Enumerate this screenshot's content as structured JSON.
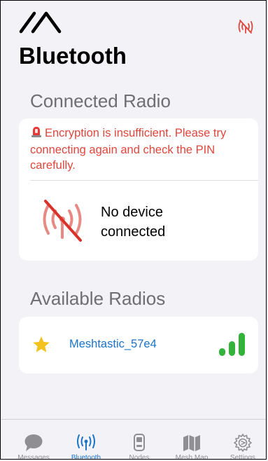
{
  "header": {
    "title": "Bluetooth",
    "logo_icon": "meshtastic-logo-icon",
    "status_icon": "antenna-off-icon"
  },
  "connected": {
    "section_title": "Connected Radio",
    "error_text": "Encryption is insufficient. Please try connecting again and check the PIN carefully.",
    "error_icon": "alarm-light-icon",
    "status_text": "No device connected",
    "status_icon": "no-connection-icon"
  },
  "available": {
    "section_title": "Available Radios",
    "radios": [
      {
        "name": "Meshtastic_57e4",
        "favorite": true,
        "signal_bars": 3,
        "signal_max": 3
      }
    ]
  },
  "tabbar": {
    "tabs": [
      {
        "label": "Messages",
        "icon": "chat-bubble-icon",
        "active": false
      },
      {
        "label": "Bluetooth",
        "icon": "antenna-icon",
        "active": true
      },
      {
        "label": "Nodes",
        "icon": "radio-device-icon",
        "active": false
      },
      {
        "label": "Mesh Map",
        "icon": "map-icon",
        "active": false
      },
      {
        "label": "Settings",
        "icon": "gear-icon",
        "active": false
      }
    ]
  },
  "colors": {
    "accent": "#1a73c8",
    "error": "#e0463c",
    "favorite": "#f4c21f",
    "signal": "#34b33a",
    "background": "#f2f2f7"
  }
}
